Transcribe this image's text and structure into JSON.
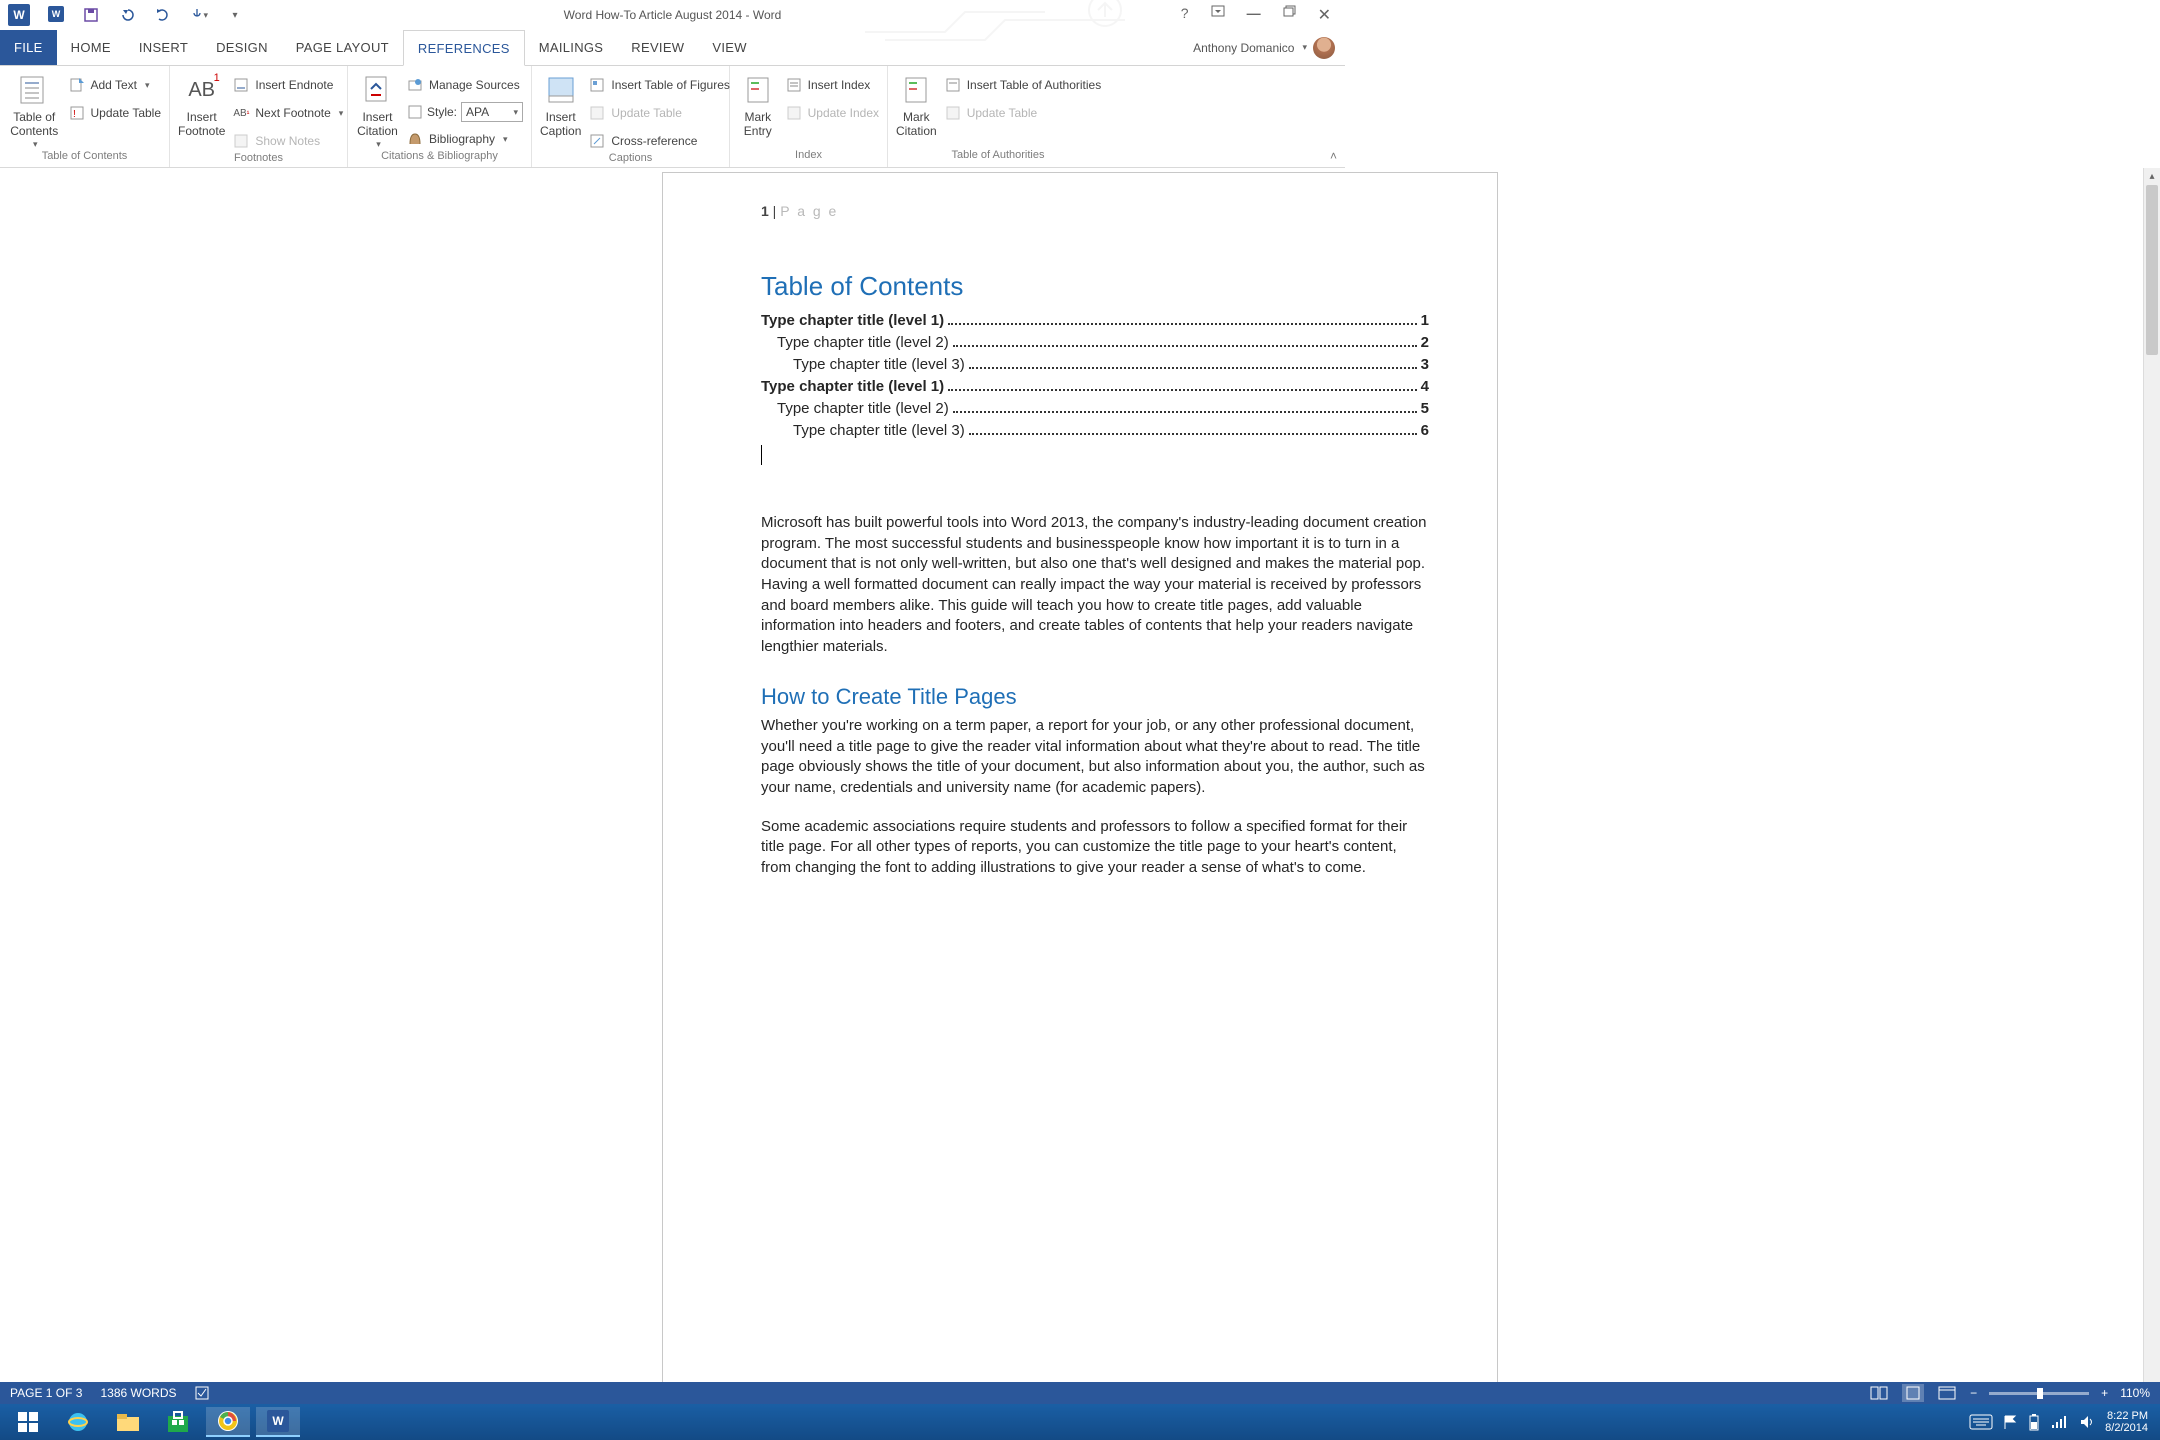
{
  "title_bar": {
    "doc_title": "Word How-To Article August 2014 - Word"
  },
  "tabs": {
    "file": "FILE",
    "home": "HOME",
    "insert": "INSERT",
    "design": "DESIGN",
    "page_layout": "PAGE LAYOUT",
    "references": "REFERENCES",
    "mailings": "MAILINGS",
    "review": "REVIEW",
    "view": "VIEW"
  },
  "user": {
    "name": "Anthony Domanico"
  },
  "ribbon": {
    "toc": {
      "big": "Table of\nContents",
      "add_text": "Add Text",
      "update": "Update Table",
      "group": "Table of Contents"
    },
    "footnotes": {
      "big": "Insert\nFootnote",
      "endnote": "Insert Endnote",
      "next": "Next Footnote",
      "show": "Show Notes",
      "group": "Footnotes"
    },
    "citations": {
      "big": "Insert\nCitation",
      "manage": "Manage Sources",
      "style_label": "Style:",
      "style_value": "APA",
      "bibliography": "Bibliography",
      "group": "Citations & Bibliography"
    },
    "captions": {
      "big": "Insert\nCaption",
      "tof": "Insert Table of Figures",
      "update": "Update Table",
      "cross": "Cross-reference",
      "group": "Captions"
    },
    "index": {
      "big": "Mark\nEntry",
      "insert": "Insert Index",
      "update": "Update Index",
      "group": "Index"
    },
    "authorities": {
      "big": "Mark\nCitation",
      "insert": "Insert Table of Authorities",
      "update": "Update Table",
      "group": "Table of Authorities"
    }
  },
  "document": {
    "header": {
      "num": "1",
      "sep": " | ",
      "label": "P a g e"
    },
    "toc_title": "Table of Contents",
    "toc": [
      {
        "level": 1,
        "text": "Type chapter title (level 1)",
        "page": "1"
      },
      {
        "level": 2,
        "text": "Type chapter title (level 2)",
        "page": "2"
      },
      {
        "level": 3,
        "text": "Type chapter title (level 3)",
        "page": "3"
      },
      {
        "level": 1,
        "text": "Type chapter title (level 1)",
        "page": "4"
      },
      {
        "level": 2,
        "text": "Type chapter title (level 2)",
        "page": "5"
      },
      {
        "level": 3,
        "text": "Type chapter title (level 3)",
        "page": "6"
      }
    ],
    "para1": "Microsoft has built powerful tools into Word 2013, the company's industry-leading document creation program. The most successful students and businesspeople know how important it is to turn in a document that is not only well-written, but also one that's well designed and makes the material pop. Having a well formatted document can really impact the way your material is received by professors and board members alike. This guide will teach you how to create title pages, add valuable information into headers and footers, and create tables of contents that help your readers navigate lengthier materials.",
    "h2": "How to Create Title Pages",
    "para2": "Whether you're working on a term paper, a report for your job, or any other professional document, you'll need a title page to give the reader vital information about what they're about to read. The title page obviously shows the title of your document, but also information about you, the author, such as your name, credentials and university name (for academic papers).",
    "para3": "Some academic associations require students and professors to follow a specified format for their title page. For all other types of reports, you can customize the title page to your heart's content, from changing the font to adding illustrations to give your reader a sense of what's to come."
  },
  "status": {
    "page": "PAGE 1 OF 3",
    "words": "1386 WORDS",
    "zoom": "110%"
  },
  "taskbar": {
    "time": "8:22 PM",
    "date": "8/2/2014"
  }
}
